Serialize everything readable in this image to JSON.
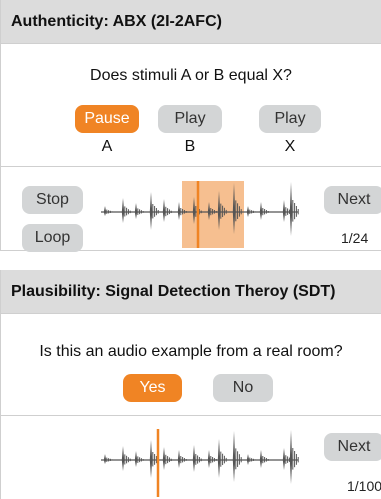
{
  "abx": {
    "title": "Authenticity: ABX (2I-2AFC)",
    "question": "Does stimuli A or B equal X?",
    "buttons": [
      {
        "label": "Pause",
        "letter": "A",
        "active": true
      },
      {
        "label": "Play",
        "letter": "B",
        "active": false
      },
      {
        "label": "Play",
        "letter": "X",
        "active": false
      }
    ],
    "stop_label": "Stop",
    "loop_label": "Loop",
    "next_label": "Next",
    "counter": "1/24"
  },
  "sdt": {
    "title": "Plausibility: Signal Detection Theroy (SDT)",
    "question": "Is this an audio example from a real room?",
    "yes_label": "Yes",
    "no_label": "No",
    "next_label": "Next",
    "counter": "1/100"
  },
  "colors": {
    "accent": "#f08424",
    "button_gray": "#d3d5d6",
    "header_gray": "#dcdcdc",
    "waveform": "#555555",
    "loop_region": "#f5b47c"
  }
}
